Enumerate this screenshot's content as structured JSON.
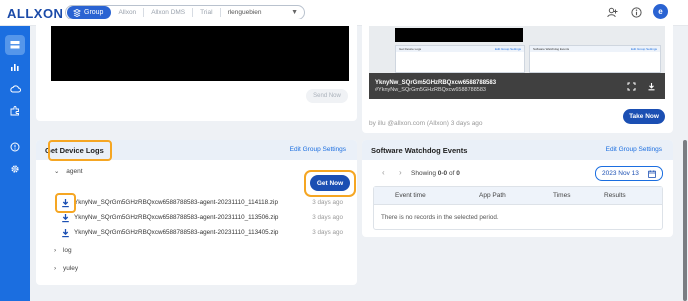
{
  "app": {
    "logo": "ALLXON",
    "avatar_letter": "e"
  },
  "breadcrumb": {
    "group_label": "Group",
    "items": [
      "Allxon",
      "Allxon DMS",
      "Trial",
      "rlenguebien"
    ]
  },
  "screen_panel": {
    "send_now_label": "Send Now"
  },
  "preview": {
    "device_id": "YknyNw_SQrGm5GHzRBQxcw6588788583",
    "device_tag": "#YknyNw_SQrGm5GHzRBQxcw6588788583",
    "mini_left_title": "Get Device Logs",
    "mini_left_link": "Edit Group Settings",
    "mini_right_title": "Software Watchdog Events",
    "mini_right_link": "Edit Group Settings",
    "byline": "by illu @allxon.com (Allxon) 3 days ago",
    "take_now_label": "Take Now"
  },
  "device_logs": {
    "title": "Get Device Logs",
    "edit_link": "Edit Group Settings",
    "get_now_label": "Get Now",
    "folders": [
      {
        "name": "agent",
        "expanded": true
      },
      {
        "name": "log",
        "expanded": false
      },
      {
        "name": "yuley",
        "expanded": false
      }
    ],
    "files": [
      {
        "name": "YknyNw_SQrGm5GHzRBQxcw6588788583-agent-20231110_114118.zip",
        "time": "3 days ago"
      },
      {
        "name": "YknyNw_SQrGm5GHzRBQxcw6588788583-agent-20231110_113506.zip",
        "time": "3 days ago"
      },
      {
        "name": "YknyNw_SQrGm5GHzRBQxcw6588788583-agent-20231110_113405.zip",
        "time": "3 days ago"
      }
    ]
  },
  "watchdog": {
    "title": "Software Watchdog Events",
    "edit_link": "Edit Group Settings",
    "showing_prefix": "Showing",
    "showing_range": "0-0",
    "showing_of": "of",
    "showing_total": "0",
    "date": "2023 Nov 13",
    "columns": [
      "Event time",
      "App Path",
      "Times",
      "Results"
    ],
    "empty_message": "There is no records in the selected period."
  },
  "colors": {
    "brand": "#1b6ee0",
    "button": "#1b4fb3",
    "highlight": "#f5a623"
  }
}
